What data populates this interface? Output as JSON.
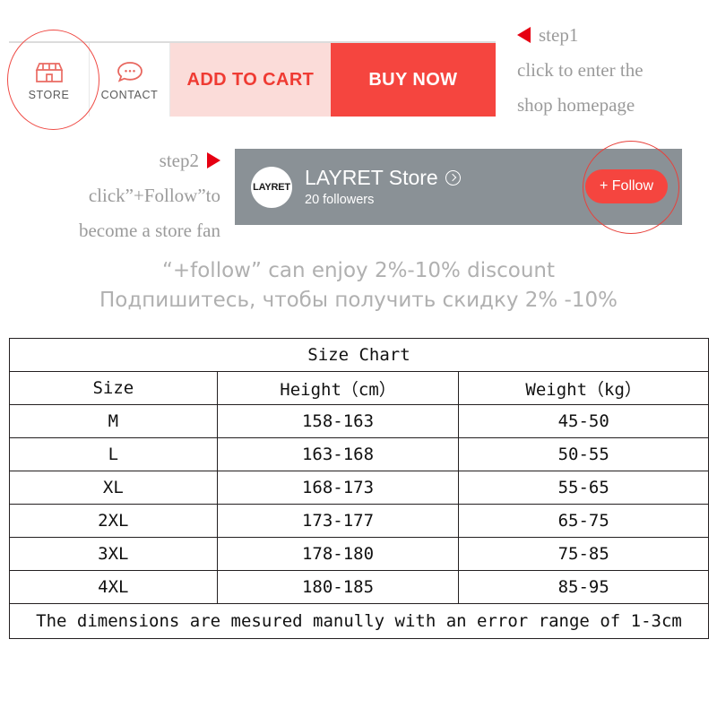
{
  "action_bar": {
    "store": {
      "label": "STORE",
      "icon": "shop-icon"
    },
    "contact": {
      "label": "CONTACT",
      "icon": "speech-bubble-icon"
    },
    "add_to_cart": "ADD TO CART",
    "buy_now": "BUY NOW",
    "colors": {
      "add_to_cart_bg": "#fbdcd9",
      "add_to_cart_text": "#ef3b33",
      "buy_now_bg": "#f5453f",
      "buy_now_text": "#ffffff",
      "highlight_ring": "#ef4b45"
    }
  },
  "annotations": {
    "step1": {
      "marker": "step1",
      "line2": "click to enter the",
      "line3": "shop homepage"
    },
    "step2": {
      "marker": "step2",
      "line2": "click”+Follow”to",
      "line3": "become a store fan"
    },
    "arrow_color": "#e60012"
  },
  "store_banner": {
    "avatar_text": "LAYRET",
    "name": "LAYRET  Store",
    "chevron_icon": "chevron-right-circle-icon",
    "followers": "20 followers",
    "follow_button": "+ Follow",
    "bg_color": "#8a9196",
    "follow_color": "#f5453f"
  },
  "discount": {
    "en": "“+follow”  can enjoy 2%-10% discount",
    "ru": "Подпишитесь, чтобы получить скидку 2% -10%",
    "color": "#b0b0b0"
  },
  "size_chart": {
    "title": "Size Chart",
    "headers": [
      "Size",
      "Height（cm）",
      "Weight（kg）"
    ],
    "rows": [
      {
        "size": "M",
        "height": "158-163",
        "weight": "45-50"
      },
      {
        "size": "L",
        "height": "163-168",
        "weight": "50-55"
      },
      {
        "size": "XL",
        "height": "168-173",
        "weight": "55-65"
      },
      {
        "size": "2XL",
        "height": "173-177",
        "weight": "65-75"
      },
      {
        "size": "3XL",
        "height": "178-180",
        "weight": "75-85"
      },
      {
        "size": "4XL",
        "height": "180-185",
        "weight": "85-95"
      }
    ],
    "note": "The dimensions are mesured manully with an error range of 1-3cm"
  }
}
